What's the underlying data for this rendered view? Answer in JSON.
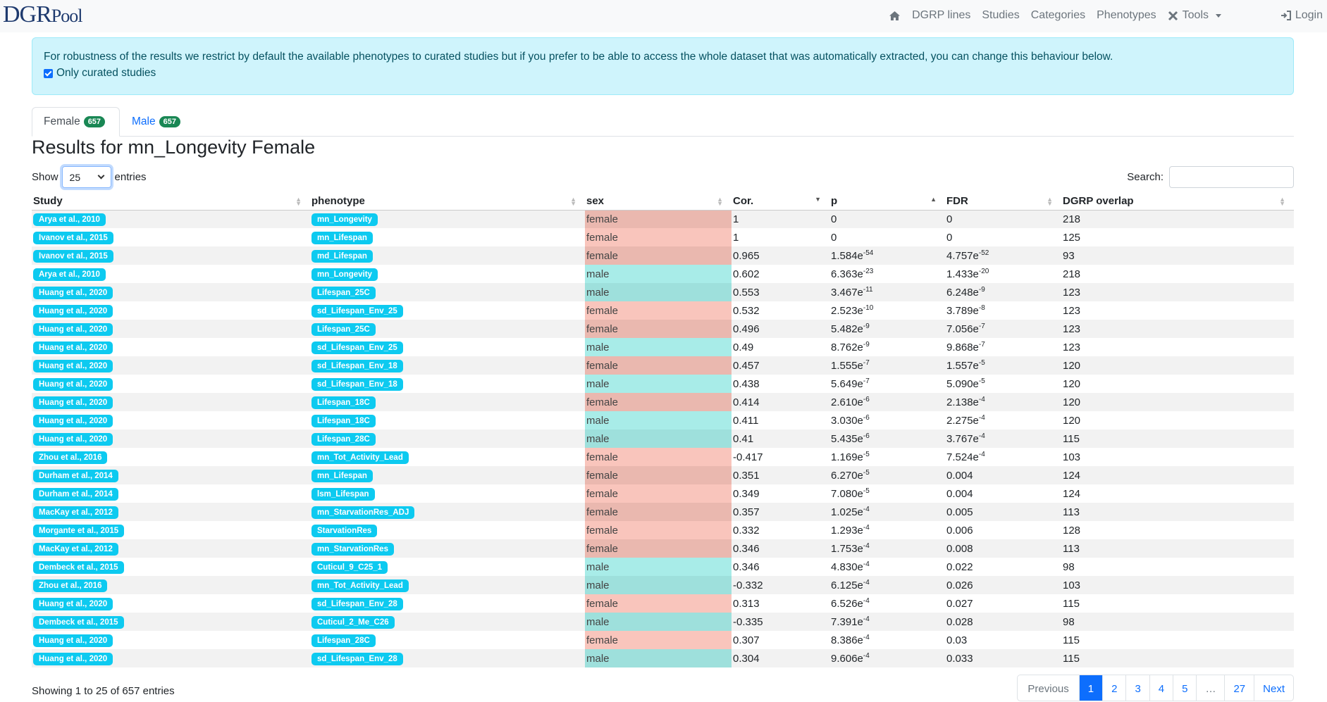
{
  "brand": {
    "part1": "DGR",
    "part2": "Pool"
  },
  "nav": {
    "items": [
      "DGRP lines",
      "Studies",
      "Categories",
      "Phenotypes",
      "Tools"
    ],
    "login": "Login"
  },
  "alert": {
    "text": "For robustness of the results we restrict by default the available phenotypes to curated studies but if you prefer to be able to access the whole dataset that was automatically extracted, you can change this behaviour below.",
    "checkbox_label": "Only curated studies",
    "checked": true
  },
  "tabs": [
    {
      "label": "Female",
      "count": "657"
    },
    {
      "label": "Male",
      "count": "657"
    }
  ],
  "title": "Results for mn_Longevity Female",
  "length": {
    "show": "Show",
    "value": "25",
    "entries": "entries"
  },
  "search": {
    "label": "Search:"
  },
  "table": {
    "headers": [
      "Study",
      "phenotype",
      "sex",
      "Cor.",
      "p",
      "FDR",
      "DGRP overlap"
    ],
    "rows": [
      {
        "study": "Arya et al., 2010",
        "phenotype": "mn_Longevity",
        "sex": "female",
        "cor": "1",
        "p": "0",
        "p_exp": "",
        "fdr": "0",
        "fdr_exp": "",
        "overlap": "218"
      },
      {
        "study": "Ivanov et al., 2015",
        "phenotype": "mn_Lifespan",
        "sex": "female",
        "cor": "1",
        "p": "0",
        "p_exp": "",
        "fdr": "0",
        "fdr_exp": "",
        "overlap": "125"
      },
      {
        "study": "Ivanov et al., 2015",
        "phenotype": "md_Lifespan",
        "sex": "female",
        "cor": "0.965",
        "p": "1.584e",
        "p_exp": "-54",
        "fdr": "4.757e",
        "fdr_exp": "-52",
        "overlap": "93"
      },
      {
        "study": "Arya et al., 2010",
        "phenotype": "mn_Longevity",
        "sex": "male",
        "cor": "0.602",
        "p": "6.363e",
        "p_exp": "-23",
        "fdr": "1.433e",
        "fdr_exp": "-20",
        "overlap": "218"
      },
      {
        "study": "Huang et al., 2020",
        "phenotype": "Lifespan_25C",
        "sex": "male",
        "cor": "0.553",
        "p": "3.467e",
        "p_exp": "-11",
        "fdr": "6.248e",
        "fdr_exp": "-9",
        "overlap": "123"
      },
      {
        "study": "Huang et al., 2020",
        "phenotype": "sd_Lifespan_Env_25",
        "sex": "female",
        "cor": "0.532",
        "p": "2.523e",
        "p_exp": "-10",
        "fdr": "3.789e",
        "fdr_exp": "-8",
        "overlap": "123"
      },
      {
        "study": "Huang et al., 2020",
        "phenotype": "Lifespan_25C",
        "sex": "female",
        "cor": "0.496",
        "p": "5.482e",
        "p_exp": "-9",
        "fdr": "7.056e",
        "fdr_exp": "-7",
        "overlap": "123"
      },
      {
        "study": "Huang et al., 2020",
        "phenotype": "sd_Lifespan_Env_25",
        "sex": "male",
        "cor": "0.49",
        "p": "8.762e",
        "p_exp": "-9",
        "fdr": "9.868e",
        "fdr_exp": "-7",
        "overlap": "123"
      },
      {
        "study": "Huang et al., 2020",
        "phenotype": "sd_Lifespan_Env_18",
        "sex": "female",
        "cor": "0.457",
        "p": "1.555e",
        "p_exp": "-7",
        "fdr": "1.557e",
        "fdr_exp": "-5",
        "overlap": "120"
      },
      {
        "study": "Huang et al., 2020",
        "phenotype": "sd_Lifespan_Env_18",
        "sex": "male",
        "cor": "0.438",
        "p": "5.649e",
        "p_exp": "-7",
        "fdr": "5.090e",
        "fdr_exp": "-5",
        "overlap": "120"
      },
      {
        "study": "Huang et al., 2020",
        "phenotype": "Lifespan_18C",
        "sex": "female",
        "cor": "0.414",
        "p": "2.610e",
        "p_exp": "-6",
        "fdr": "2.138e",
        "fdr_exp": "-4",
        "overlap": "120"
      },
      {
        "study": "Huang et al., 2020",
        "phenotype": "Lifespan_18C",
        "sex": "male",
        "cor": "0.411",
        "p": "3.030e",
        "p_exp": "-6",
        "fdr": "2.275e",
        "fdr_exp": "-4",
        "overlap": "120"
      },
      {
        "study": "Huang et al., 2020",
        "phenotype": "Lifespan_28C",
        "sex": "male",
        "cor": "0.41",
        "p": "5.435e",
        "p_exp": "-6",
        "fdr": "3.767e",
        "fdr_exp": "-4",
        "overlap": "115"
      },
      {
        "study": "Zhou et al., 2016",
        "phenotype": "mn_Tot_Activity_Lead",
        "sex": "female",
        "cor": "-0.417",
        "p": "1.169e",
        "p_exp": "-5",
        "fdr": "7.524e",
        "fdr_exp": "-4",
        "overlap": "103"
      },
      {
        "study": "Durham et al., 2014",
        "phenotype": "mn_Lifespan",
        "sex": "female",
        "cor": "0.351",
        "p": "6.270e",
        "p_exp": "-5",
        "fdr": "0.004",
        "fdr_exp": "",
        "overlap": "124"
      },
      {
        "study": "Durham et al., 2014",
        "phenotype": "lsm_Lifespan",
        "sex": "female",
        "cor": "0.349",
        "p": "7.080e",
        "p_exp": "-5",
        "fdr": "0.004",
        "fdr_exp": "",
        "overlap": "124"
      },
      {
        "study": "MacKay et al., 2012",
        "phenotype": "mn_StarvationRes_ADJ",
        "sex": "female",
        "cor": "0.357",
        "p": "1.025e",
        "p_exp": "-4",
        "fdr": "0.005",
        "fdr_exp": "",
        "overlap": "113"
      },
      {
        "study": "Morgante et al., 2015",
        "phenotype": "StarvationRes",
        "sex": "female",
        "cor": "0.332",
        "p": "1.293e",
        "p_exp": "-4",
        "fdr": "0.006",
        "fdr_exp": "",
        "overlap": "128"
      },
      {
        "study": "MacKay et al., 2012",
        "phenotype": "mn_StarvationRes",
        "sex": "female",
        "cor": "0.346",
        "p": "1.753e",
        "p_exp": "-4",
        "fdr": "0.008",
        "fdr_exp": "",
        "overlap": "113"
      },
      {
        "study": "Dembeck et al., 2015",
        "phenotype": "Cuticul_9_C25_1",
        "sex": "male",
        "cor": "0.346",
        "p": "4.830e",
        "p_exp": "-4",
        "fdr": "0.022",
        "fdr_exp": "",
        "overlap": "98"
      },
      {
        "study": "Zhou et al., 2016",
        "phenotype": "mn_Tot_Activity_Lead",
        "sex": "male",
        "cor": "-0.332",
        "p": "6.125e",
        "p_exp": "-4",
        "fdr": "0.026",
        "fdr_exp": "",
        "overlap": "103"
      },
      {
        "study": "Huang et al., 2020",
        "phenotype": "sd_Lifespan_Env_28",
        "sex": "female",
        "cor": "0.313",
        "p": "6.526e",
        "p_exp": "-4",
        "fdr": "0.027",
        "fdr_exp": "",
        "overlap": "115"
      },
      {
        "study": "Dembeck et al., 2015",
        "phenotype": "Cuticul_2_Me_C26",
        "sex": "male",
        "cor": "-0.335",
        "p": "7.391e",
        "p_exp": "-4",
        "fdr": "0.028",
        "fdr_exp": "",
        "overlap": "98"
      },
      {
        "study": "Huang et al., 2020",
        "phenotype": "Lifespan_28C",
        "sex": "female",
        "cor": "0.307",
        "p": "8.386e",
        "p_exp": "-4",
        "fdr": "0.03",
        "fdr_exp": "",
        "overlap": "115"
      },
      {
        "study": "Huang et al., 2020",
        "phenotype": "sd_Lifespan_Env_28",
        "sex": "male",
        "cor": "0.304",
        "p": "9.606e",
        "p_exp": "-4",
        "fdr": "0.033",
        "fdr_exp": "",
        "overlap": "115"
      }
    ]
  },
  "info": "Showing 1 to 25 of 657 entries",
  "pagination": {
    "previous": "Previous",
    "pages": [
      "1",
      "2",
      "3",
      "4",
      "5",
      "…",
      "27"
    ],
    "active": "1",
    "next": "Next"
  },
  "colors": {
    "female": "#f9c5bc",
    "male": "#a8ece8",
    "badge": "#0dcaf0",
    "pill": "#198754",
    "accent": "#0d6efd"
  }
}
